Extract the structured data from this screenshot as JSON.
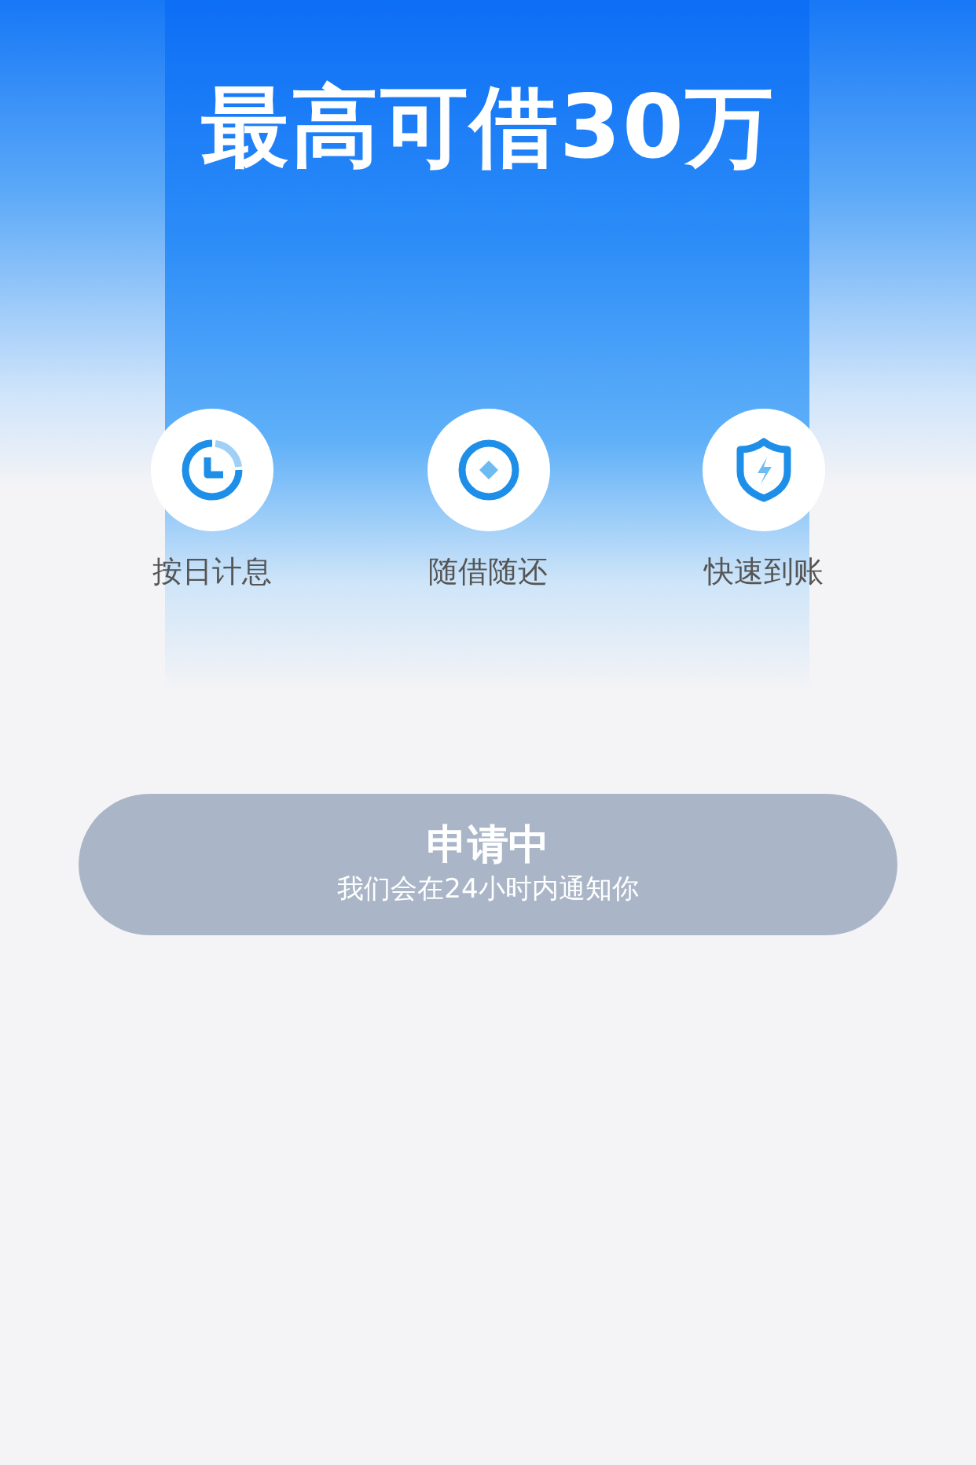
{
  "title": "最高可借30万",
  "features": [
    {
      "kind": "clock",
      "label": "按日计息"
    },
    {
      "kind": "coin",
      "label": "随借随还"
    },
    {
      "kind": "shield",
      "label": "快速到账"
    }
  ],
  "apply_button": {
    "label": "申请中",
    "note": "我们会在24小时内通知你",
    "disabled": true
  }
}
